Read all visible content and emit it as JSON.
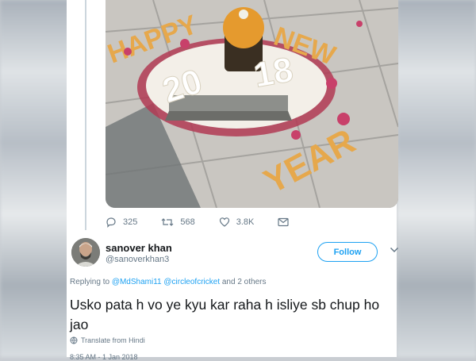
{
  "tweet": {
    "media_alt": "flower rangoli around a shivling reading Happy 2018 New Year",
    "stats": {
      "replies": "325",
      "retweets": "568",
      "likes": "3.8K"
    }
  },
  "reply": {
    "name": "sanover khan",
    "handle": "@sanoverkhan3",
    "follow_label": "Follow",
    "replying_prefix": "Replying to",
    "mention_1": "@MdShami11",
    "mention_2": "@circleofcricket",
    "replying_suffix": "and 2 others",
    "text": "Usko pata h vo ye kyu kar raha h isliye sb chup ho jao",
    "translate_label": "Translate from Hindi",
    "timestamp": "8:35 AM - 1 Jan 2018"
  },
  "icons": {
    "reply": "reply-icon",
    "retweet": "retweet-icon",
    "like": "heart-icon",
    "dm": "envelope-icon",
    "more": "chevron-down-icon",
    "translate": "globe-icon"
  },
  "colors": {
    "accent": "#1da1f2",
    "muted": "#657786",
    "text": "#14171a",
    "thread_line": "#ccd6dd"
  }
}
